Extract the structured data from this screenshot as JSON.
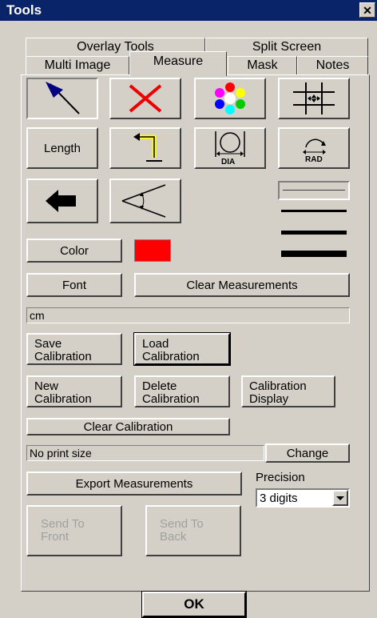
{
  "window": {
    "title": "Tools",
    "close": "✕"
  },
  "tabs": {
    "row1": [
      "Overlay Tools",
      "Split Screen"
    ],
    "row2": [
      "Multi Image",
      "Measure",
      "Mask",
      "Notes"
    ],
    "active": "Measure"
  },
  "tools": {
    "length_label": "Length",
    "dia_label": "DIA",
    "rad_label": "RAD"
  },
  "colors": {
    "current_color": "#ff0000",
    "arrow_blue": "#000080",
    "highlight_yellow": "#ffff00"
  },
  "buttons": {
    "color": "Color",
    "font": "Font",
    "clear_measurements": "Clear Measurements",
    "save_calibration": "Save\nCalibration",
    "load_calibration": "Load\nCalibration",
    "new_calibration": "New\nCalibration",
    "delete_calibration": "Delete\nCalibration",
    "calibration_display": "Calibration\nDisplay",
    "clear_calibration": "Clear Calibration",
    "change": "Change",
    "export_measurements": "Export Measurements",
    "send_to_front": "Send To\nFront",
    "send_to_back": "Send To\nBack",
    "ok": "OK"
  },
  "unit_field": {
    "value": "cm"
  },
  "print_size": {
    "value": "No print size"
  },
  "precision": {
    "label": "Precision",
    "value": "3 digits"
  }
}
